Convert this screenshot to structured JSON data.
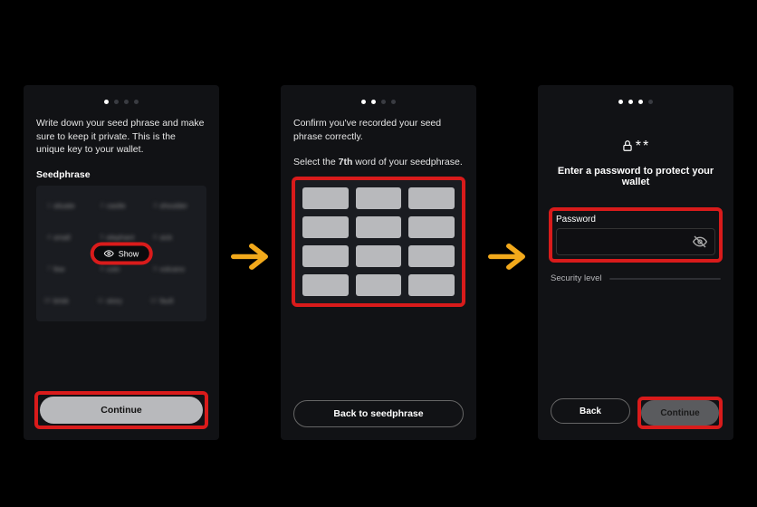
{
  "panel1": {
    "intro": "Write down your seed phrase and make sure to keep it private. This is the unique key to your wallet.",
    "label": "Seedphrase",
    "words": [
      {
        "n": "1",
        "w": "situate"
      },
      {
        "n": "2",
        "w": "castle"
      },
      {
        "n": "3",
        "w": "shoulder"
      },
      {
        "n": "4",
        "w": "small"
      },
      {
        "n": "5",
        "w": "elephant"
      },
      {
        "n": "6",
        "w": "sick"
      },
      {
        "n": "7",
        "w": "few"
      },
      {
        "n": "8",
        "w": "coin"
      },
      {
        "n": "9",
        "w": "volcano"
      },
      {
        "n": "10",
        "w": "brisk"
      },
      {
        "n": "11",
        "w": "story"
      },
      {
        "n": "12",
        "w": "fault"
      }
    ],
    "show_label": "Show",
    "continue_label": "Continue"
  },
  "panel2": {
    "intro": "Confirm you've recorded your seed phrase correctly.",
    "select_prefix": "Select the ",
    "select_nth": "7th",
    "select_suffix": " word of your seedphrase.",
    "back_label": "Back to seedphrase"
  },
  "panel3": {
    "masked": "**",
    "prompt": "Enter a password to protect your wallet",
    "pw_label": "Password",
    "security_label": "Security level",
    "back_label": "Back",
    "continue_label": "Continue"
  }
}
